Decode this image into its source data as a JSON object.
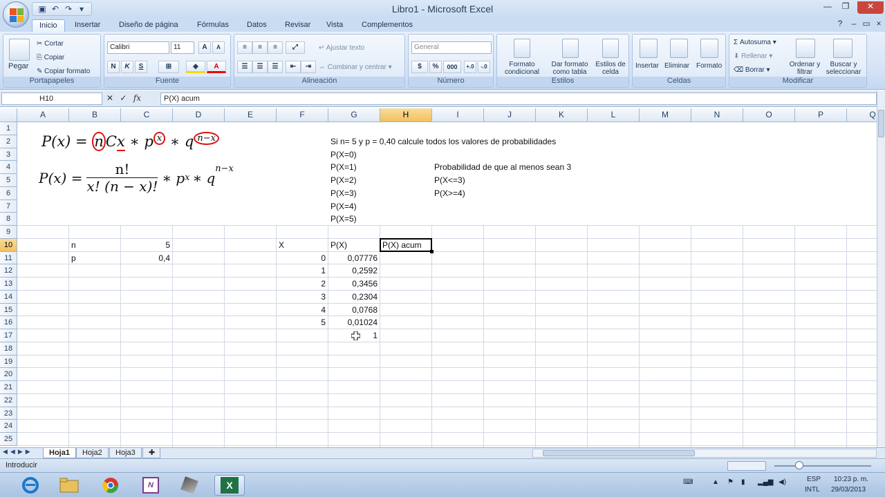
{
  "window": {
    "title": "Libro1 - Microsoft Excel"
  },
  "quick_access": {
    "icons": [
      "save-icon",
      "undo-icon",
      "redo-icon",
      "customize-icon"
    ]
  },
  "tabs": [
    "Inicio",
    "Insertar",
    "Diseño de página",
    "Fórmulas",
    "Datos",
    "Revisar",
    "Vista",
    "Complementos"
  ],
  "ribbon": {
    "portapapeles": {
      "name": "Portapapeles",
      "paste": "Pegar",
      "cut": "Cortar",
      "copy": "Copiar",
      "format_painter": "Copiar formato"
    },
    "fuente": {
      "name": "Fuente",
      "font": "Calibri",
      "size": "11",
      "bold": "N",
      "italic": "K",
      "underline": "S",
      "grow": "A",
      "shrink": "A"
    },
    "alineacion": {
      "name": "Alineación",
      "wrap": "Ajustar texto",
      "merge": "Combinar y centrar"
    },
    "numero": {
      "name": "Número",
      "format": "General",
      "currency": "$",
      "percent": "%",
      "thousands": "000"
    },
    "estilos": {
      "name": "Estilos",
      "conditional": "Formato condicional",
      "as_table": "Dar formato como tabla",
      "cell_styles": "Estilos de celda"
    },
    "celdas": {
      "name": "Celdas",
      "insert": "Insertar",
      "delete": "Eliminar",
      "format": "Formato"
    },
    "modificar": {
      "name": "Modificar",
      "autosum": "Autosuma",
      "fill": "Rellenar",
      "clear": "Borrar",
      "sort": "Ordenar y filtrar",
      "find": "Buscar y seleccionar"
    }
  },
  "formula_bar": {
    "name_box": "H10",
    "fx": "fx",
    "content": "P(X) acum"
  },
  "columns": [
    "A",
    "B",
    "C",
    "D",
    "E",
    "F",
    "G",
    "H",
    "I",
    "J",
    "K",
    "L",
    "M",
    "N",
    "O",
    "P",
    "Q"
  ],
  "rows": [
    "1",
    "2",
    "3",
    "4",
    "5",
    "6",
    "7",
    "8",
    "9",
    "10",
    "11",
    "12",
    "13",
    "14",
    "15",
    "16",
    "17",
    "18",
    "19",
    "20",
    "21",
    "22",
    "23",
    "24",
    "25"
  ],
  "formulas": {
    "f1_lhs": "P(x) =",
    "f1_n": "n",
    "f1_c": "C",
    "f1_x": "x",
    "f1_star1": "∗",
    "f1_p": "p",
    "f1_px": "x",
    "f1_star2": "∗",
    "f1_q": "q",
    "f1_qexp": "n−x",
    "f2_lhs": "P(x) =",
    "f2_num": "n!",
    "f2_den": "x! (n − x)!",
    "f2_rest": "∗ p",
    "f2_rest_exp": "x",
    "f2_rest2": "∗ q",
    "f2_rest2_exp": "n−x"
  },
  "cells": {
    "G2": "Si n= 5 y p = 0,40 calcule todos los valores de probabilidades",
    "G3": "P(X=0)",
    "G4": "P(X=1)",
    "G5": "P(X=2)",
    "G6": "P(X=3)",
    "G7": "P(X=4)",
    "G8": "P(X=5)",
    "I4": "Probabilidad de que al menos sean 3",
    "I5": "P(X<=3)",
    "I6": "P(X>=4)",
    "B10": "n",
    "C10": "5",
    "F10": "X",
    "G10": "P(X)",
    "H10": "P(X) acum",
    "B11": "p",
    "C11": "0,4",
    "F11": "0",
    "G11": "0,07776",
    "F12": "1",
    "G12": "0,2592",
    "F13": "2",
    "G13": "0,3456",
    "F14": "3",
    "G14": "0,2304",
    "F15": "4",
    "G15": "0,0768",
    "F16": "5",
    "G16": "0,01024",
    "G17": "1"
  },
  "sheets": [
    "Hoja1",
    "Hoja2",
    "Hoja3"
  ],
  "status": {
    "mode": "Introducir"
  },
  "tray": {
    "lang1": "ESP",
    "lang2": "INTL",
    "time": "10:23 p. m.",
    "date": "29/03/2013"
  },
  "colors": {
    "accent": "#f1c15f",
    "ribbon": "#dce8f7",
    "excel_green": "#1f7244"
  }
}
